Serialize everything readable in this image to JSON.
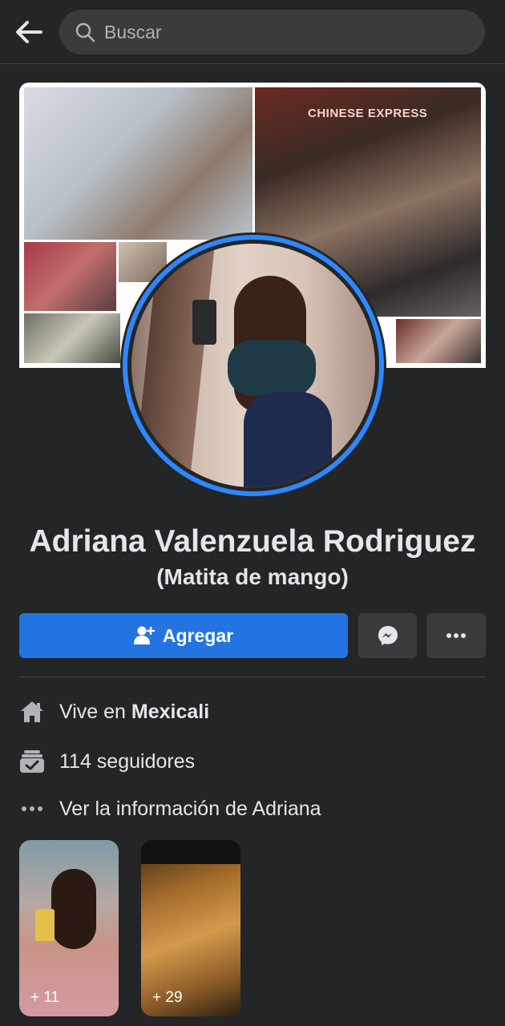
{
  "search": {
    "placeholder": "Buscar"
  },
  "cover": {
    "sign_text": "CHINESE EXPRESS"
  },
  "profile": {
    "name": "Adriana Valenzuela Rodriguez",
    "nickname": "(Matita de mango)"
  },
  "actions": {
    "add_label": "Agregar",
    "add_icon": "add-friend-icon",
    "message_icon": "messenger-icon",
    "more_icon": "more-icon"
  },
  "info": {
    "lives_prefix": "Vive en",
    "lives_city": "Mexicali",
    "followers": "114 seguidores",
    "see_info": "Ver la información de Adriana"
  },
  "albums": [
    {
      "count": "+ 11"
    },
    {
      "count": "+ 29"
    }
  ],
  "colors": {
    "background": "#242526",
    "accent": "#2374e1",
    "ring": "#2d88ff",
    "button_secondary": "#3a3b3c"
  }
}
